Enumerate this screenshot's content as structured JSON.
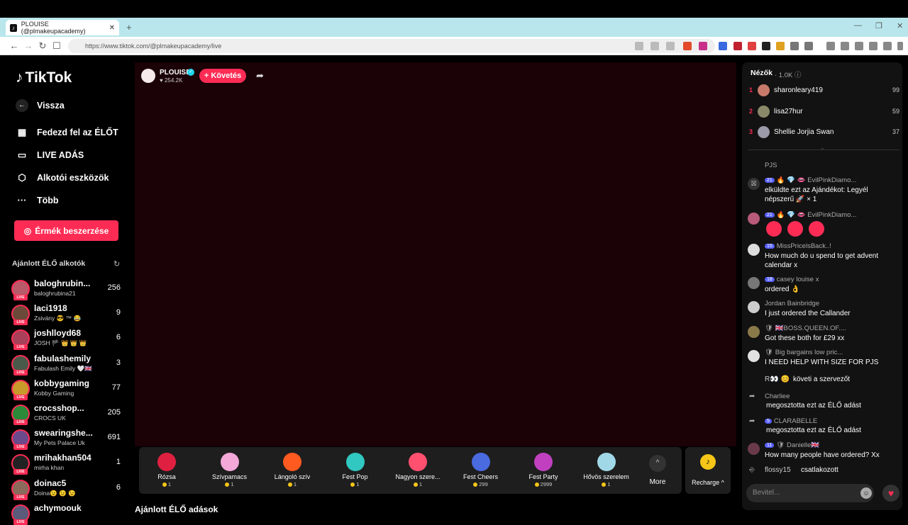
{
  "browser": {
    "tab_title": "PLOUISE (@plmakeupacademy)",
    "tab_close": "✕",
    "new_tab": "+",
    "url": "https://www.tiktok.com/@plmakeupacademy/live",
    "win_min": "—",
    "win_max": "❐",
    "win_close": "✕"
  },
  "sidebar": {
    "logo": "TikTok",
    "back": "Vissza",
    "items": [
      {
        "label": "Fedezd fel az ÉLŐT",
        "icon": "calendar-icon"
      },
      {
        "label": "LIVE ADÁS",
        "icon": "camera-icon"
      },
      {
        "label": "Alkotói eszközök",
        "icon": "tools-icon"
      },
      {
        "label": "Több",
        "icon": "more-icon"
      }
    ],
    "coins_button": "Érmék beszerzése",
    "recommended_title": "Ajánlott ÉLŐ alkotók",
    "recommended_more": "Ajánlott ÉLŐ adások",
    "creators": [
      {
        "name": "baloghrubin...",
        "sub": "baloghrubina21",
        "count": "256",
        "color": "#b85a6a"
      },
      {
        "name": "laci1918",
        "sub": "Zsivány 😎 ™ 😂",
        "count": "9",
        "color": "#6b4a3a"
      },
      {
        "name": "joshlloyd68",
        "sub": "JOSH 🏴 👑 👑 👑",
        "count": "6",
        "color": "#a8405a"
      },
      {
        "name": "fabulashemily",
        "sub": "Fabulash Emily 🤍🇬🇧",
        "count": "3",
        "color": "#4a5a4a"
      },
      {
        "name": "kobbygaming",
        "sub": "Kobby Gaming",
        "count": "77",
        "color": "#c89a2a"
      },
      {
        "name": "crocsshop...",
        "sub": "CROCS UK",
        "count": "205",
        "color": "#2a8a3a"
      },
      {
        "name": "swearingshe...",
        "sub": "My Pets Palace Uk",
        "count": "691",
        "color": "#6a4a8a"
      },
      {
        "name": "mrihakhan504",
        "sub": "mirha khan",
        "count": "1",
        "color": "#222222"
      },
      {
        "name": "doinac5",
        "sub": "Doina😉 😉 😉",
        "count": "6",
        "color": "#8a6a5a"
      },
      {
        "name": "achymoouk",
        "sub": "",
        "count": "",
        "color": "#5a5a7a"
      }
    ],
    "live_badge": "LIVE"
  },
  "host": {
    "name": "PLOUISE",
    "likes": "♥ 254.2K",
    "follow": "+ Követés",
    "verified": "✓"
  },
  "gifts": [
    {
      "name": "Rózsa",
      "price": "1",
      "color": "#e02040"
    },
    {
      "name": "Szívpamacs",
      "price": "1",
      "color": "#f4a8d8"
    },
    {
      "name": "Lángoló szív",
      "price": "1",
      "color": "#ff5a20"
    },
    {
      "name": "Fest Pop",
      "price": "1",
      "color": "#30c8c0"
    },
    {
      "name": "Nagyon szere...",
      "price": "1",
      "color": "#ff5070"
    },
    {
      "name": "Fest Cheers",
      "price": "299",
      "color": "#4a6ae0"
    },
    {
      "name": "Fest Party",
      "price": "2999",
      "color": "#c040c0"
    },
    {
      "name": "Hővös szerelem",
      "price": "1",
      "color": "#a0d8e8"
    }
  ],
  "gift_more": "More",
  "gift_more_icon": "^",
  "recharge": "Recharge ^",
  "recharge_icon": "♪",
  "panel": {
    "viewers_title": "Nézők",
    "viewers_count": "· 1.0K ⓘ",
    "viewers": [
      {
        "rank": "1",
        "name": "sharonleary419",
        "score": "99",
        "color": "#c87a6a"
      },
      {
        "rank": "2",
        "name": "lisa27hur",
        "score": "59",
        "color": "#8a8a6a"
      },
      {
        "rank": "3",
        "name": "Shellie Jorjia Swan",
        "score": "37",
        "color": "#9a9aaa"
      }
    ],
    "chat_header": "PJS",
    "messages": [
      {
        "level": "21",
        "name": "🔥 💎 👄 EvilPinkDiamo...",
        "text": "elküldte ezt az Ajándékot: Legyél népszerű 🚀 × 1",
        "icon": "gift-icon"
      },
      {
        "level": "21",
        "name": "🔥 💎 👄 EvilPinkDiamo...",
        "text": "",
        "icon": "avatar"
      },
      {
        "level": "15",
        "name": "MissPricelsBack..!",
        "text": "How much do u spend to get advent calendar x",
        "icon": "avatar"
      },
      {
        "level": "18",
        "name": "casey louise x",
        "text": "ordered 👌",
        "icon": "avatar"
      },
      {
        "level": "",
        "name": "Jordan Bainbridge",
        "text": "I just ordered the Callander",
        "icon": "avatar"
      },
      {
        "level": "",
        "name": "🛡 🇬🇧BOSS.QUEEN.OF....",
        "text": "Got these both for £29 xx",
        "icon": "avatar"
      },
      {
        "level": "",
        "name": "🛡 Big bargains low pric...",
        "text": "I NEED HELP WITH SIZE FOR PJS",
        "icon": "avatar"
      }
    ],
    "follow_event": {
      "user": "R👀 😊",
      "text": "követi a szervezőt"
    },
    "share_events": [
      {
        "user": "Charliee",
        "text": "megosztotta ezt az ÉLŐ adást",
        "level": ""
      },
      {
        "user": "CLARABELLE",
        "text": "megosztotta ezt az ÉLŐ adást",
        "level": "5"
      }
    ],
    "last_msg": {
      "level": "11",
      "name": "🛡 Danielle🇬🇧",
      "text": "How many people have ordered? Xx"
    },
    "join_event": {
      "user": "flossy15",
      "text": "csatlakozott"
    },
    "input_placeholder": "Bevitel..."
  },
  "colors": {
    "accent": "#fe2c55",
    "panel": "#121212",
    "video_bg": "#1a0206",
    "coin": "#f5c518"
  }
}
